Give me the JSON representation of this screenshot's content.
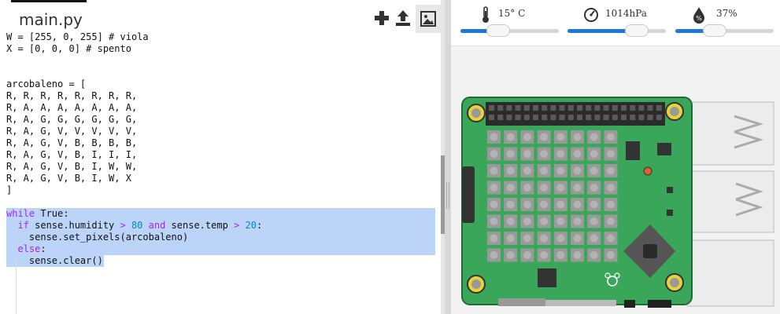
{
  "editor": {
    "tab_label": "main.py",
    "toolbar": {
      "add_icon": "plus-icon",
      "upload_icon": "upload-icon",
      "image_icon": "image-icon"
    },
    "code_lines": {
      "l1": "W = [255, 0, 255] # viola",
      "l2": "X = [0, 0, 0] # spento",
      "l5": "arcobaleno = [",
      "l6": "R, R, R, R, R, R, R, R,",
      "l7": "R, A, A, A, A, A, A, A,",
      "l8": "R, A, G, G, G, G, G, G,",
      "l9": "R, A, G, V, V, V, V, V,",
      "l10": "R, A, G, V, B, B, B, B,",
      "l11": "R, A, G, V, B, I, I, I,",
      "l12": "R, A, G, V, B, I, W, W,",
      "l13": "R, A, G, V, B, I, W, X",
      "l14": "]",
      "l16a": "while",
      "l16b": " True:",
      "l17a": "  if",
      "l17b": " sense.humidity ",
      "l17c": ">",
      "l17d": " 80",
      "l17e": " and",
      "l17f": " sense.temp ",
      "l17g": ">",
      "l17h": " 20",
      "l17i": ":",
      "l18": "    sense.set_pixels(arcobaleno)",
      "l19a": "  else",
      "l19b": ":",
      "l20": "    sense.clear()"
    }
  },
  "emulator": {
    "sensors": {
      "temperature": {
        "value": "15° C",
        "icon": "thermometer-icon",
        "level": 0.38
      },
      "pressure": {
        "value": "1014hPa",
        "icon": "gauge-icon",
        "level": 0.7
      },
      "humidity": {
        "value": "37%",
        "icon": "humidity-drop-icon",
        "level": 0.4
      }
    },
    "board": {
      "name": "Sense HAT on Raspberry Pi",
      "led_rows": 8,
      "led_cols": 8
    }
  },
  "colors": {
    "selection": "#bcd4f7",
    "keyword": "#aa22ff",
    "number": "#0088cc",
    "comment": "#008000",
    "slider_fill": "#1e78dc",
    "board_green": "#3aa65a"
  }
}
